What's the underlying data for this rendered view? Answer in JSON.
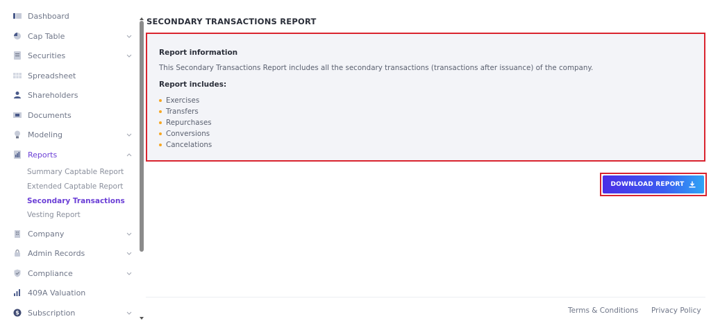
{
  "sidebar": {
    "items": [
      {
        "label": "Dashboard",
        "icon": "dashboard-icon",
        "chevron": false
      },
      {
        "label": "Cap Table",
        "icon": "pie-chart-icon",
        "chevron": "down"
      },
      {
        "label": "Securities",
        "icon": "document-icon",
        "chevron": "down"
      },
      {
        "label": "Spreadsheet",
        "icon": "grid-icon",
        "chevron": false
      },
      {
        "label": "Shareholders",
        "icon": "user-icon",
        "chevron": false
      },
      {
        "label": "Documents",
        "icon": "folder-icon",
        "chevron": false
      },
      {
        "label": "Modeling",
        "icon": "lightbulb-icon",
        "chevron": "down"
      },
      {
        "label": "Reports",
        "icon": "report-icon",
        "chevron": "up",
        "active": true
      },
      {
        "label": "Company",
        "icon": "building-icon",
        "chevron": "down"
      },
      {
        "label": "Admin Records",
        "icon": "lock-icon",
        "chevron": "down"
      },
      {
        "label": "Compliance",
        "icon": "shield-icon",
        "chevron": "down"
      },
      {
        "label": "409A Valuation",
        "icon": "bar-chart-icon",
        "chevron": false
      },
      {
        "label": "Subscription",
        "icon": "dollar-icon",
        "chevron": "down"
      }
    ],
    "reports_subitems": [
      {
        "label": "Summary Captable Report"
      },
      {
        "label": "Extended Captable Report"
      },
      {
        "label": "Secondary Transactions",
        "active": true
      },
      {
        "label": "Vesting Report"
      }
    ]
  },
  "main": {
    "title": "SECONDARY TRANSACTIONS REPORT",
    "info_heading": "Report information",
    "info_description": "This Secondary Transactions Report includes all the secondary transactions (transactions after issuance) of the company.",
    "includes_heading": "Report includes:",
    "includes": [
      "Exercises",
      "Transfers",
      "Repurchases",
      "Conversions",
      "Cancelations"
    ],
    "download_label": "DOWNLOAD REPORT"
  },
  "footer": {
    "terms": "Terms & Conditions",
    "privacy": "Privacy Policy"
  },
  "colors": {
    "accent": "#6b3fd6",
    "highlight_border": "#d9232e",
    "bullet": "#f5a623",
    "button_gradient_start": "#4b2ee6",
    "button_gradient_end": "#2fa4f5"
  }
}
